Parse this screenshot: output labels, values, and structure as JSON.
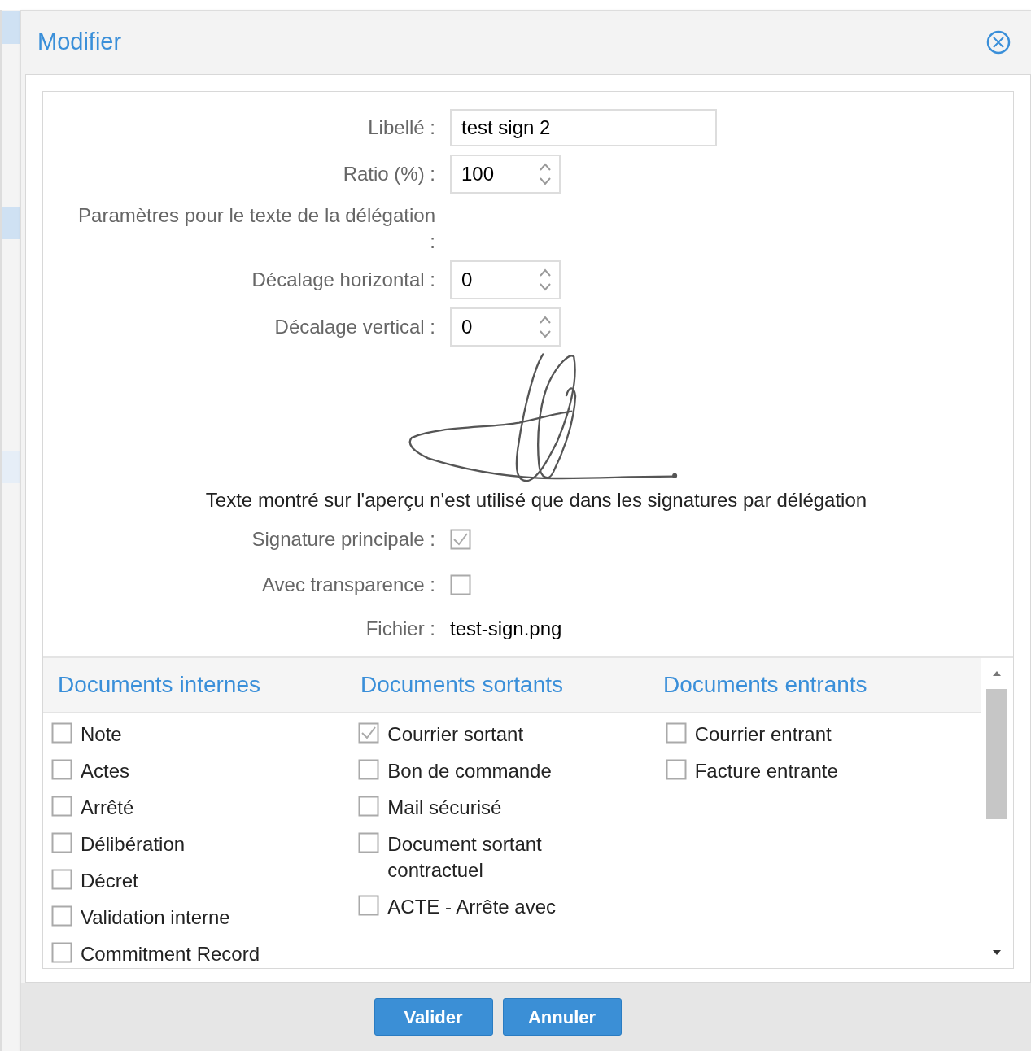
{
  "dialog": {
    "title": "Modifier"
  },
  "form": {
    "rows": [
      {
        "kind": "text",
        "label": "Libellé :",
        "value": "test sign 2"
      },
      {
        "kind": "number",
        "label": "Ratio (%) :",
        "value": "100"
      },
      {
        "kind": "heading",
        "label": "Paramètres pour le texte de la délégation",
        "suffix": ":"
      },
      {
        "kind": "number",
        "label": "Décalage horizontal :",
        "value": "0"
      },
      {
        "kind": "number",
        "label": "Décalage vertical :",
        "value": "0"
      },
      {
        "kind": "signature"
      },
      {
        "kind": "note",
        "label": "Texte montré sur l'aperçu n'est utilisé que dans les signatures par délégation"
      },
      {
        "kind": "checkbox",
        "label": "Signature principale :",
        "checked": true
      },
      {
        "kind": "checkbox",
        "label": "Avec transparence :",
        "checked": false
      },
      {
        "kind": "file",
        "label": "Fichier :",
        "value": "test-sign.png"
      }
    ]
  },
  "documents": {
    "columns": [
      {
        "heading": "Documents internes",
        "items": [
          {
            "label": "Note",
            "checked": false
          },
          {
            "label": "Actes",
            "checked": false
          },
          {
            "label": "Arrêté",
            "checked": false
          },
          {
            "label": "Délibération",
            "checked": false
          },
          {
            "label": "Décret",
            "checked": false
          },
          {
            "label": "Validation interne",
            "checked": false
          },
          {
            "label": "Commitment Record",
            "checked": false
          }
        ]
      },
      {
        "heading": "Documents sortants",
        "items": [
          {
            "label": "Courrier sortant",
            "checked": true
          },
          {
            "label": "Bon de commande",
            "checked": false
          },
          {
            "label": "Mail sécurisé",
            "checked": false
          },
          {
            "label": "Document sortant contractuel",
            "checked": false
          },
          {
            "label": "ACTE - Arrête avec",
            "checked": false
          }
        ]
      },
      {
        "heading": "Documents entrants",
        "items": [
          {
            "label": "Courrier entrant",
            "checked": false
          },
          {
            "label": "Facture entrante",
            "checked": false
          }
        ]
      }
    ]
  },
  "buttons": [
    "Valider",
    "Annuler"
  ]
}
